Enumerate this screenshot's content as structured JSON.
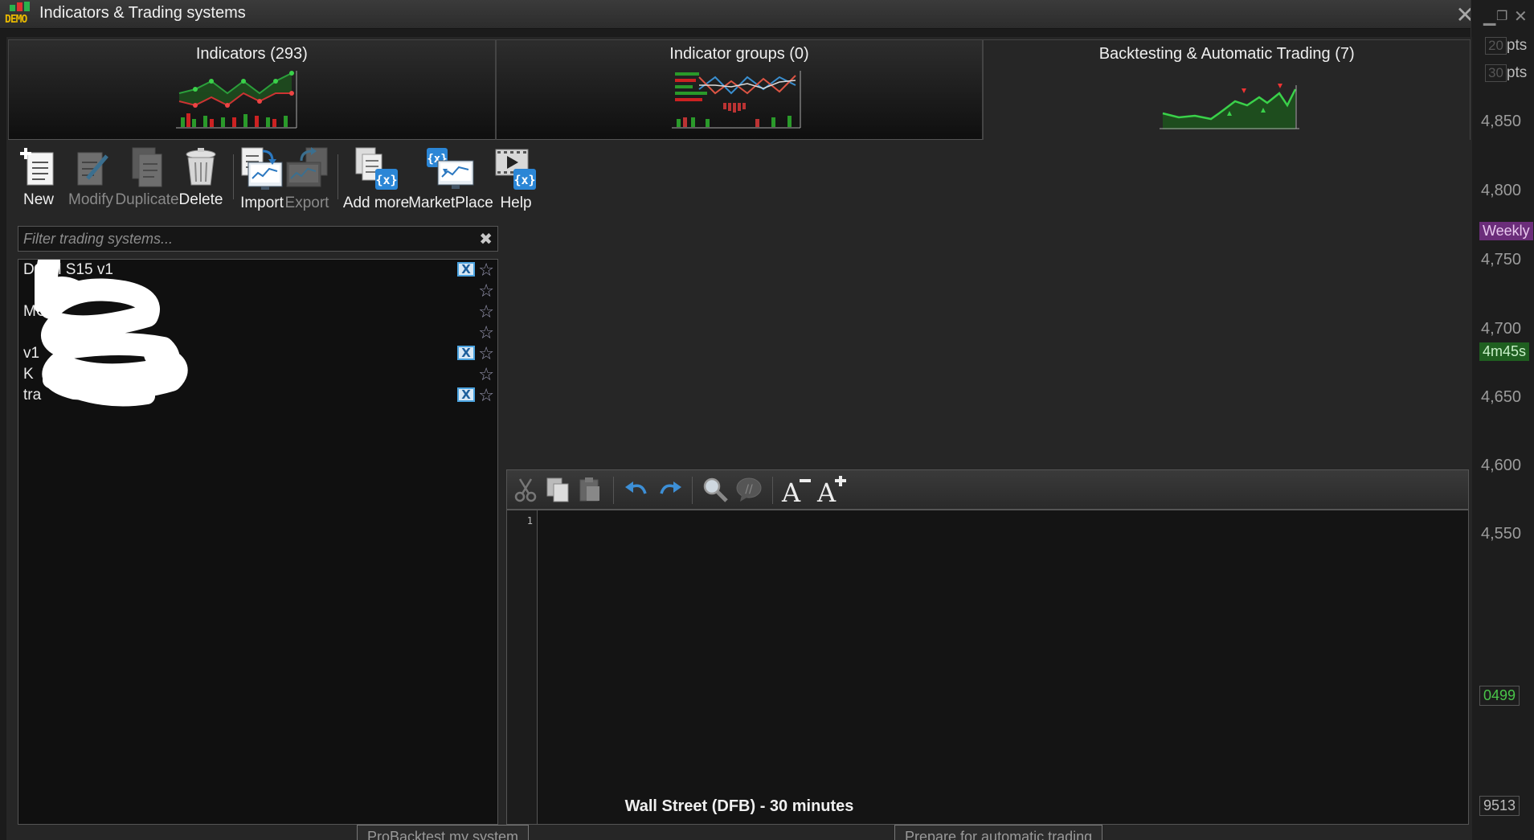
{
  "window": {
    "title": "Indicators & Trading systems",
    "logo_text": "DEMO",
    "close_glyph": "✕"
  },
  "tabs": [
    {
      "label": "Indicators (293)",
      "active": false
    },
    {
      "label": "Indicator groups (0)",
      "active": false
    },
    {
      "label": "Backtesting & Automatic Trading (7)",
      "active": true
    }
  ],
  "toolbar": {
    "new": "New",
    "modify": "Modify",
    "duplicate": "Duplicate",
    "delete": "Delete",
    "import": "Import",
    "export": "Export",
    "add_more": "Add more",
    "marketplace": "MarketPlace",
    "help": "Help"
  },
  "filter": {
    "placeholder": "Filter trading systems...",
    "clear_glyph": "✖"
  },
  "systems": [
    {
      "name": "Dax     ll S15 v1",
      "has_x": true
    },
    {
      "name": "",
      "has_x": false
    },
    {
      "name": "                  MOD",
      "has_x": false
    },
    {
      "name": "",
      "has_x": false
    },
    {
      "name": "                         v1",
      "has_x": true
    },
    {
      "name": "                          K",
      "has_x": false
    },
    {
      "name": "tra",
      "has_x": true
    }
  ],
  "editor": {
    "line_number": "1"
  },
  "footer": {
    "instrument": "Wall Street (DFB) - 30 minutes",
    "probacktest_button": "ProBacktest my system",
    "prepare_button": "Prepare for automatic trading"
  },
  "background_chart": {
    "pts_1": "20",
    "pts_2": "30",
    "pts_unit": "pts",
    "prices": [
      "4,850",
      "4,800",
      "4,750",
      "4,700",
      "4,650",
      "4,600",
      "4,550"
    ],
    "weekly_tag": "Weekly",
    "timer_tag": "4m45s",
    "value_1": "0499",
    "value_2": "9513"
  }
}
